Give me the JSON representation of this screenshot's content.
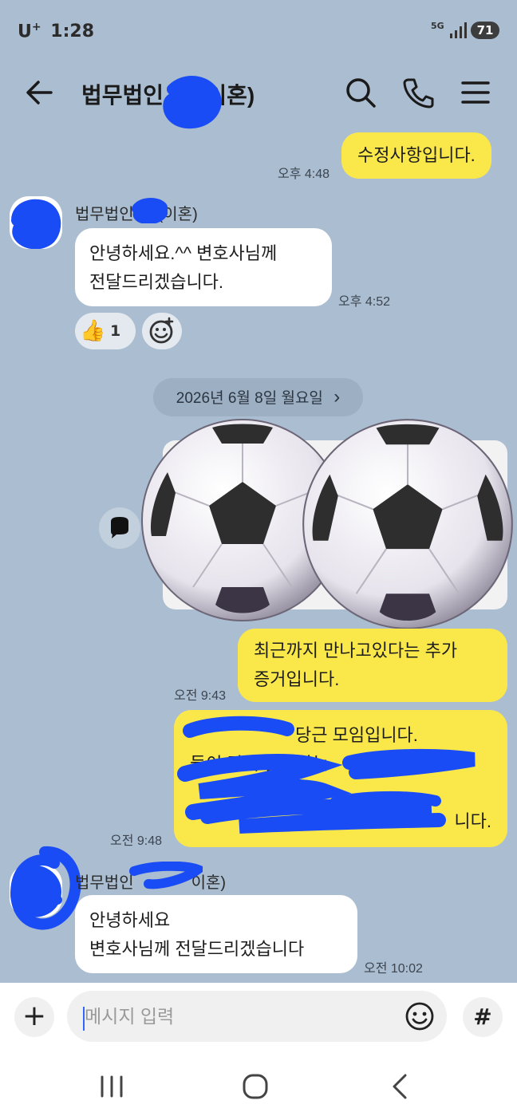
{
  "status_bar": {
    "carrier": "U",
    "carrier_sup": "+",
    "time": "1:28",
    "network": "5G",
    "battery": "71"
  },
  "header": {
    "title": "법무법인",
    "title_suffix": "(이혼)"
  },
  "messages": [
    {
      "id": "m1",
      "side": "mine",
      "text": "수정사항입니다.",
      "time": "오후 4:48"
    },
    {
      "id": "m2",
      "side": "theirs",
      "sender": "법무법인",
      "sender_suffix": "(이혼)",
      "lines": [
        "안녕하세요.^^ 변호사님께",
        "전달드리겠습니다."
      ],
      "time": "오후 4:52",
      "reaction": {
        "emoji": "👍",
        "count": "1"
      }
    },
    {
      "id": "m3",
      "side": "mine",
      "lines": [
        "최근까지 만나고있다는 추가",
        "증거입니다."
      ],
      "time": "오전 9:43"
    },
    {
      "id": "m4",
      "side": "mine",
      "lines": [
        "당근 모임입니다.",
        "둘이 같이 활동하는",
        "",
        "니다."
      ],
      "time": "오전 9:48"
    },
    {
      "id": "m5",
      "side": "theirs",
      "sender": "법무법인",
      "sender_suffix": "이혼)",
      "lines": [
        "안녕하세요",
        "변호사님께 전달드리겠습니다"
      ],
      "time": "오전 10:02"
    }
  ],
  "date_divider": "2026년 6월 8일 월요일",
  "date_divider_chevron": "›",
  "input": {
    "placeholder": "메시지 입력",
    "plus": "+",
    "hash": "#"
  },
  "colors": {
    "chat_background": "#abbdd0",
    "my_bubble": "#fae84b",
    "their_bubble": "#ffffff",
    "redaction": "#1a4cf5"
  },
  "icons": {
    "back": "arrow-left-icon",
    "search": "search-icon",
    "call": "phone-icon",
    "menu": "hamburger-menu-icon",
    "share": "speech-bubble-icon",
    "emoji": "smiley-icon",
    "add_reaction": "add-emoji-icon"
  }
}
